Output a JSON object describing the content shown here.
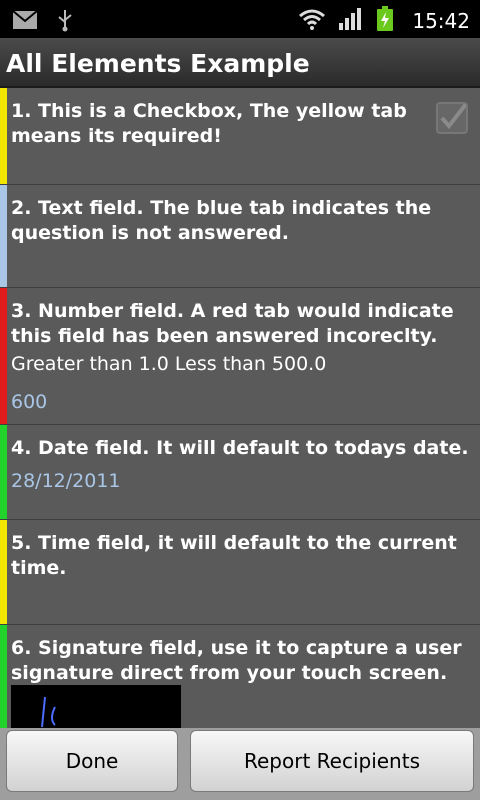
{
  "status_bar": {
    "time": "15:42",
    "icons": [
      "gmail-icon",
      "usb-icon",
      "wifi-icon",
      "signal-icon",
      "battery-charging-icon"
    ]
  },
  "app": {
    "title": "All Elements Example"
  },
  "items": [
    {
      "question": "1. This is a Checkbox, The yellow tab means its required!",
      "tab_color": "#f2e500",
      "checked": true
    },
    {
      "question": "2. Text field. The blue tab indicates the question is not answered.",
      "tab_color": "#a9c6e6"
    },
    {
      "question": "3. Number field. A red tab would indicate this field has been answered incoreclty.",
      "tab_color": "#e11b1b",
      "hint": "Greater than 1.0 Less than 500.0",
      "value": "600"
    },
    {
      "question": "4. Date field. It will default to todays date.",
      "tab_color": "#22d22a",
      "value": "28/12/2011"
    },
    {
      "question": "5. Time field, it will default to the current time.",
      "tab_color": "#f2e500"
    },
    {
      "question": "6. Signature field, use it to capture a user signature direct from your touch screen.",
      "tab_color": "#22d22a"
    }
  ],
  "buttons": {
    "done": "Done",
    "report": "Report Recipients"
  }
}
